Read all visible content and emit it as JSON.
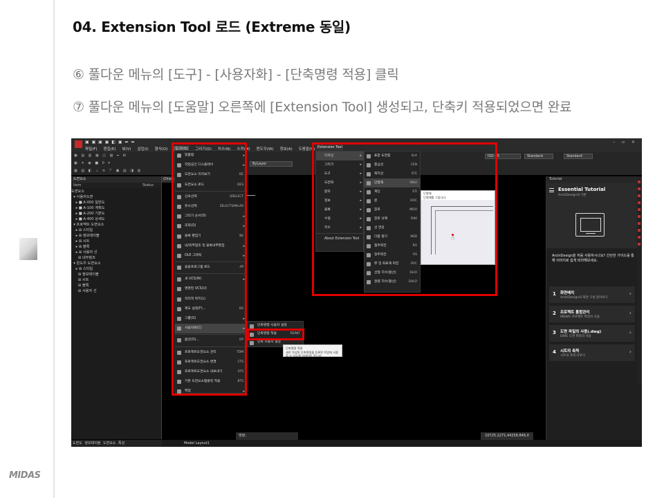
{
  "slide": {
    "title": "04. Extension Tool 로드 (Extreme 동일)",
    "step6": "⑥ 풀다운 메뉴의 [도구] - [사용자화] - [단축명령 적용] 클릭",
    "step7": "⑦ 풀다운 메뉴의 [도움말] 오른쪽에 [Extension Tool] 생성되고, 단축키 적용되었으면 완료",
    "logo": "MIDAS"
  },
  "app": {
    "menubar": [
      "파일(F)",
      "편집(E)",
      "뷰(V)",
      "삽입(I)",
      "형식(O)",
      "도구(T)",
      "그리기(D)",
      "치수(N)",
      "수정(M)",
      "윈도우(W)",
      "정보(A)",
      "도움말(H)"
    ],
    "active_menu_index": 5,
    "layer_dropdown": "ByLayer",
    "dim_style": "ISO-25",
    "text_style": "Standard",
    "table_style": "Standard",
    "left_panel_title": "도면요소",
    "col_item": "Item",
    "col_status": "Status",
    "drawing_tab": "(Draw...",
    "tree": [
      "도면요소",
      "  ▾ 사용자도면",
      "    ▸ ■ A-000 일반도",
      "    ▸ ■ A-100 계획도",
      "    ▸ ■ A-200 기본도",
      "    ▸ ■ A-400 상세도",
      "  ▾ 프로젝트 도면요소",
      "    ▸ ⊞ 스타일",
      "    ▸ ⊞ 정보테이블",
      "    ▸ ⊞ 시트",
      "    ▸ ⊞ 블록",
      "    ▸ ⊞ 사용자 선",
      "      ⊞ 내부참조",
      "  ▾ 윈도우 도면요소",
      "    ▸ ⊞ 스타일",
      "      ⊞ 정보테이블",
      "      ⊞ 시트",
      "      ⊞ 블록",
      "      ⊞ 사용자 선"
    ],
    "bottom_tabs": "도면도 정보테이블 도면요소 특성",
    "model_tabs": "Model  Layout1",
    "command_label": "명령:",
    "coordinates": "10725.2271,44258.846,0"
  },
  "tools_menu": [
    {
      "label": "맞춤법",
      "sc": "",
      "arrow": true
    },
    {
      "label": "작업공간 디스플레이",
      "sc": "",
      "arrow": true
    },
    {
      "label": "도면요소 미리보기",
      "sc": "DE",
      "arrow": false
    },
    {
      "label": "도면요소 로드",
      "sc": "DES",
      "arrow": false
    },
    {
      "sep": true
    },
    {
      "label": "신속선택",
      "sc": "QSELECT",
      "arrow": false
    },
    {
      "label": "유사선택",
      "sc": "SELECTSIMILAR",
      "arrow": false
    },
    {
      "label": "그리기 순서(D)",
      "sc": "",
      "arrow": true
    },
    {
      "label": "조회(Q)",
      "sc": "",
      "arrow": true
    },
    {
      "label": "블록 편집기",
      "sc": "BE",
      "arrow": false
    },
    {
      "label": "내/외부참조 및 블록내부편집",
      "sc": "",
      "arrow": true
    },
    {
      "label": "OLE 그래픽",
      "sc": "",
      "arrow": true
    },
    {
      "sep": true
    },
    {
      "label": "응용프로그램 로드",
      "sc": "AP",
      "arrow": false
    },
    {
      "sep": true
    },
    {
      "label": "새 UCS(W)",
      "sc": "",
      "arrow": true
    },
    {
      "label": "명명된 UCS(U)",
      "sc": "",
      "arrow": false
    },
    {
      "label": "지리적 위치(L)",
      "sc": "",
      "arrow": false
    },
    {
      "label": "제도 설정(F)...",
      "sc": "DS",
      "arrow": false
    },
    {
      "label": "그룹(G)",
      "sc": "",
      "arrow": true
    },
    {
      "label": "사용자화(C)",
      "sc": "",
      "arrow": true,
      "active": true
    },
    {
      "sep": true
    },
    {
      "label": "옵션(O)...",
      "sc": "OP",
      "arrow": false
    },
    {
      "sep": true
    },
    {
      "label": "프로젝트도면요소 관리",
      "sc": "TDM",
      "arrow": false
    },
    {
      "label": "프로젝트도면요소 변경",
      "sc": "CTS",
      "arrow": false
    },
    {
      "label": "프로젝트도면요소 내보내기",
      "sc": "STS",
      "arrow": false
    },
    {
      "label": "기본 도면요소템플릿 적용",
      "sc": "BTS",
      "arrow": false
    },
    {
      "label": "백업",
      "sc": "",
      "arrow": true
    }
  ],
  "custom_submenu": [
    {
      "label": "단축명령 사용자 설정",
      "sc": ""
    },
    {
      "label": "단축명령 적용",
      "sc": "REINIT"
    },
    {
      "label": "단축 사용자 설정",
      "sc": ""
    }
  ],
  "custom_tooltip": {
    "title": "단축명령 적용",
    "body": "새로 작성된 단축명령을 등록된 작업에 사용할 수 있도록 업데이트 합니다."
  },
  "ext": {
    "tab_label": "Extension Tool",
    "menu": [
      "디자인",
      "그리기",
      "도구",
      "도면화",
      "문자",
      "정보",
      "블록",
      "수정",
      "치수",
      "About Extension Tool"
    ],
    "submenu": [
      {
        "label": "표준 도면틀",
        "sc": "SLA"
      },
      {
        "label": "중심선",
        "sc": "CEN"
      },
      {
        "label": "재치선",
        "sc": "STE"
      },
      {
        "label": "단열재",
        "sc": "INSU",
        "active": true
      },
      {
        "label": "계단",
        "sc": "STI"
      },
      {
        "label": "문",
        "sc": "DOC"
      },
      {
        "label": "창호",
        "sc": "WDO"
      },
      {
        "label": "창호 삭제",
        "sc": "DWI"
      },
      {
        "label": "선 연장",
        "sc": ""
      },
      {
        "label": "다중 평기",
        "sc": "MEB"
      },
      {
        "label": "점주회전",
        "sc": "RO"
      },
      {
        "label": "정주회전",
        "sc": "RS"
      },
      {
        "label": "뷰 및 좌표계 회전",
        "sc": "RVC"
      },
      {
        "label": "선형 치수(활선)",
        "sc": "DLIO"
      },
      {
        "label": "정렬 치수(활선)",
        "sc": "DALO"
      }
    ],
    "preview_title": "단열재",
    "preview_sub": "단열재를 그립니다."
  },
  "tutorial": {
    "panel_title": "Tutorial",
    "title": "Essential Tutorial",
    "subtitle": "ArchiDesign의 기본",
    "question": "ArchiDesign을 처음 사용하시나요? 간단한 가이드를 통해 이미지로 쉽게 따라해보세요.",
    "cards": [
      {
        "num": "1",
        "title": "화면배치",
        "sub": "ArchiDesign의 화면 구성 알아보기"
      },
      {
        "num": "2",
        "title": "프로젝트 통합관리",
        "sub": "MDWG 프로젝트 파일의 사용"
      },
      {
        "num": "3",
        "title": "도면 파일의 사용(.dwg)",
        "sub": "DWG 도면 파일의 사용"
      },
      {
        "num": "4",
        "title": "시트의 축척",
        "sub": "시트의 축척 다루기"
      }
    ]
  }
}
